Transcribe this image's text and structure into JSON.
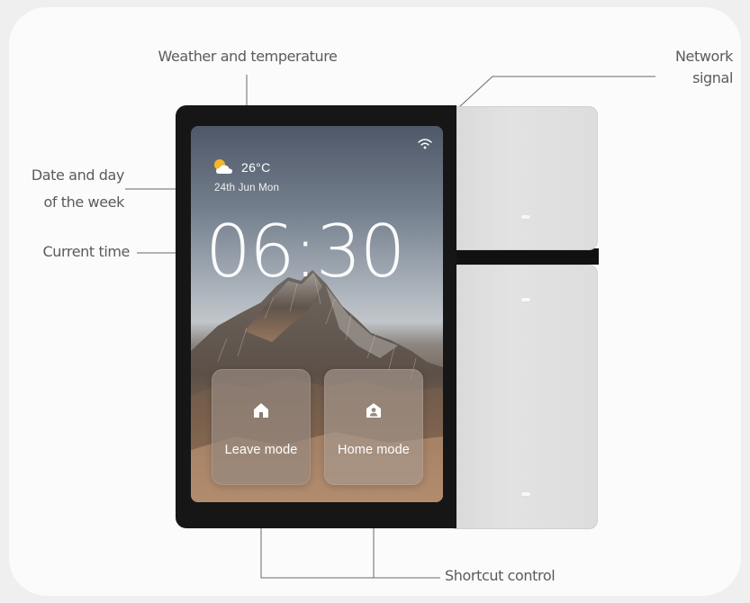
{
  "annotations": {
    "weather": "Weather and temperature",
    "network_line1": "Network",
    "network_line2": "signal",
    "date_line1": "Date and day",
    "date_line2": "of the week",
    "current_time": "Current time",
    "shortcut": "Shortcut control"
  },
  "screen": {
    "temperature": "26°C",
    "date": "24th Jun  Mon",
    "time": "06:30",
    "weather_icon": "partly-cloudy-icon",
    "network_icon": "wifi-icon",
    "modes": [
      {
        "label": "Leave mode",
        "icon": "house-icon"
      },
      {
        "label": "Home mode",
        "icon": "home-person-icon"
      }
    ]
  },
  "colors": {
    "background": "#efefef",
    "card": "#fbfbfb",
    "frame": "#161616",
    "panel": "#dfdfdf",
    "annotation_text": "#5b5b5b"
  }
}
